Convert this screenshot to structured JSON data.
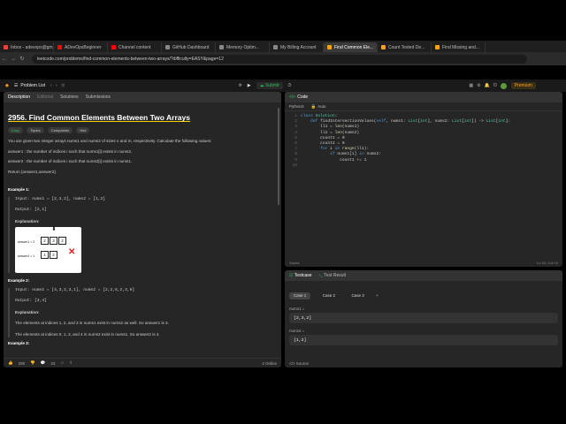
{
  "browser": {
    "tabs": [
      {
        "label": "Inbox - adevops@gmail.com",
        "color": "#ea4335"
      },
      {
        "label": "ADevOpsBeginner",
        "color": "#ff0000"
      },
      {
        "label": "Channel content",
        "color": "#ff0000"
      },
      {
        "label": "GitHub Dashboard",
        "color": "#888888"
      },
      {
        "label": "Memory Optim...",
        "color": "#888888"
      },
      {
        "label": "My Billing Account",
        "color": "#888888"
      },
      {
        "label": "Find Common Ele...",
        "color": "#ffa116",
        "active": true
      },
      {
        "label": "Count Tested De...",
        "color": "#ffa116"
      },
      {
        "label": "Find Missing and...",
        "color": "#ffa116"
      }
    ],
    "url": "leetcode.com/problems/find-common-elements-between-two-arrays/?difficulty=EASY&page=12"
  },
  "lcheader": {
    "problem_list": "Problem List",
    "submit": "Submit",
    "premium": "Premium"
  },
  "left": {
    "tabs": [
      "Description",
      "Editorial",
      "Solutions",
      "Submissions"
    ],
    "title": "2956. Find Common Elements Between Two Arrays",
    "chips": [
      "Easy",
      "Topics",
      "Companies",
      "Hint"
    ],
    "intro": "You are given two integer arrays nums1 and nums2 of sizes n and m, respectively. Calculate the following values:",
    "bullet1": "answer1 : the number of indices i such that nums1[i] exists in nums2.",
    "bullet2": "answer2 : the number of indices i such that nums2[i] exists in nums1.",
    "return": "Return [answer1,answer2].",
    "example1_title": "Example 1:",
    "ex1_input": "Input: nums1 = [2,3,2], nums2 = [1,2]",
    "ex1_output": "Output: [2,1]",
    "ex1_expl": "Explanation:",
    "illus_a1": "answer1 = 2",
    "illus_a2": "answer2 = 1",
    "example2_title": "Example 2:",
    "ex2_input": "Input: nums1 = [4,3,2,3,1], nums2 = [2,2,5,2,3,6]",
    "ex2_output": "Output: [3,4]",
    "ex2_expl": "Explanation:",
    "ex2_line1": "The elements at indices 1, 2, and 3 in nums1 exist in nums2 as well. So answer1 is 3.",
    "ex2_line2": "The elements at indices 0, 1, 3, and 4 in nums2 exist in nums1. So answer2 is 4.",
    "example3_title": "Example 3:",
    "likes": "290",
    "comments": "23",
    "online": "4 Online"
  },
  "code": {
    "header": "Code",
    "lang": "Python3",
    "mode": "Auto",
    "saved": "Saved",
    "cursor": "Ln 10, Col 15",
    "lines": [
      "class Solution:",
      "    def findIntersectionValues(self, nums1: List[int], nums2: List[int]) -> List[int]:",
      "        ll1 = len(nums1)",
      "        ll2 = len(nums2)",
      "        count1 = 0",
      "        count2 = 0",
      "        for i in range(ll1):",
      "            if nums1[i] in nums2:",
      "                count1 += 1",
      "            "
    ]
  },
  "testcase": {
    "tab1": "Testcase",
    "tab2": "Test Result",
    "cases": [
      "Case 1",
      "Case 2",
      "Case 3"
    ],
    "nums1_label": "nums1 =",
    "nums1_value": "[2,3,2]",
    "nums2_label": "nums2 =",
    "nums2_value": "[1,2]",
    "source": "Source"
  }
}
